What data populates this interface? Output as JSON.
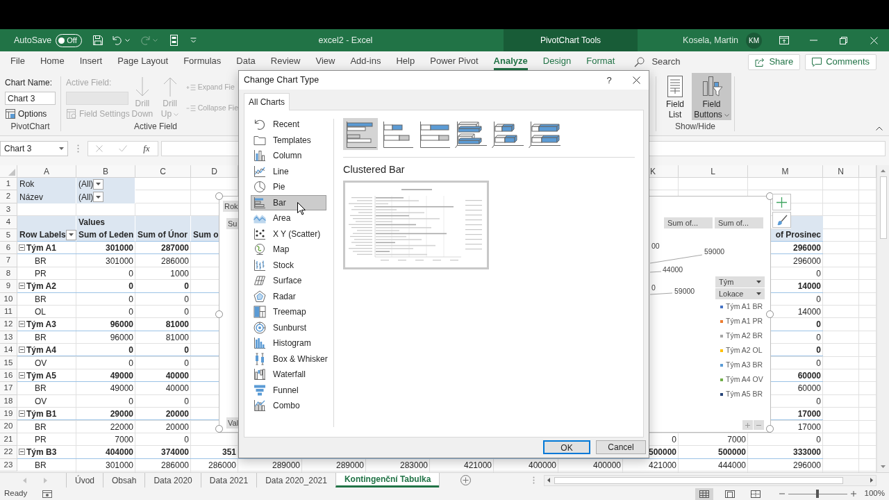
{
  "title_bar": {
    "autosave_label": "AutoSave",
    "autosave": {
      "on": false,
      "label": "Off"
    },
    "document_title": "excel2 - Excel",
    "context_label": "PivotChart Tools",
    "user_name": "Kosela, Martin",
    "user_initials": "KM"
  },
  "menu_tabs": [
    {
      "label": "File",
      "selected": false,
      "contextual": false
    },
    {
      "label": "Home",
      "selected": false,
      "contextual": false
    },
    {
      "label": "Insert",
      "selected": false,
      "contextual": false
    },
    {
      "label": "Page Layout",
      "selected": false,
      "contextual": false
    },
    {
      "label": "Formulas",
      "selected": false,
      "contextual": false
    },
    {
      "label": "Data",
      "selected": false,
      "contextual": false
    },
    {
      "label": "Review",
      "selected": false,
      "contextual": false
    },
    {
      "label": "View",
      "selected": false,
      "contextual": false
    },
    {
      "label": "Add-ins",
      "selected": false,
      "contextual": false
    },
    {
      "label": "Help",
      "selected": false,
      "contextual": false
    },
    {
      "label": "Power Pivot",
      "selected": false,
      "contextual": false
    },
    {
      "label": "Analyze",
      "selected": true,
      "contextual": true
    },
    {
      "label": "Design",
      "selected": false,
      "contextual": true
    },
    {
      "label": "Format",
      "selected": false,
      "contextual": true
    }
  ],
  "search": {
    "placeholder": "Search"
  },
  "share_button": "Share",
  "comments_button": "Comments",
  "ribbon": {
    "pivotchart": {
      "group_label": "PivotChart",
      "name_label": "Chart Name:",
      "name_value": "Chart 3",
      "options": "Options"
    },
    "active_field": {
      "group_label": "Active Field",
      "disabled": true,
      "field_label": "Active Field:",
      "field_settings": "Field Settings",
      "drill_down": "Drill Down",
      "drill_up": "Drill Up",
      "expand": "Expand Fie",
      "collapse": "Collapse Fie"
    },
    "show_hide": {
      "group_label": "Show/Hide",
      "buttons": [
        {
          "label": "Field List",
          "pressed": false
        },
        {
          "label": "Field Buttons",
          "pressed": true
        }
      ]
    }
  },
  "formula_bar": {
    "name_box": "Chart 3",
    "function_label": "fx"
  },
  "sheet": {
    "column_headers": {
      "col_a": "A",
      "col_b": "B",
      "col_c": "C",
      "col_d": "D",
      "col_k": "K",
      "col_l": "L",
      "col_m": "M",
      "col_n": "N"
    },
    "rows": [
      {
        "number": "1",
        "kind": "filter",
        "cells": {
          "col_a": "Rok",
          "col_b": "(All)"
        }
      },
      {
        "number": "2",
        "kind": "filter",
        "cells": {
          "col_a": "Název",
          "col_b": "(All)"
        }
      },
      {
        "number": "3",
        "kind": "blank"
      },
      {
        "number": "4",
        "kind": "values_header",
        "cells": {
          "col_b": "Values"
        }
      },
      {
        "number": "5",
        "kind": "column_labels",
        "cells": {
          "col_a": "Row Labels",
          "col_b": "Sum of Leden",
          "col_c": "Sum of Únor",
          "col_d": "Sum o",
          "col_m": "of Prosinec"
        }
      },
      {
        "number": "6",
        "kind": "group",
        "expanded": true,
        "cells": {
          "col_a": "Tým A1",
          "col_b": "301000",
          "col_c": "287000",
          "col_m": "296000"
        }
      },
      {
        "number": "7",
        "kind": "item",
        "cells": {
          "col_a": "BR",
          "col_b": "301000",
          "col_c": "286000",
          "col_m": "296000"
        }
      },
      {
        "number": "8",
        "kind": "item",
        "cells": {
          "col_a": "PR",
          "col_b": "0",
          "col_c": "1000",
          "col_m": "0"
        }
      },
      {
        "number": "9",
        "kind": "group",
        "expanded": true,
        "cells": {
          "col_a": "Tým A2",
          "col_b": "0",
          "col_c": "0",
          "col_m": "14000"
        }
      },
      {
        "number": "10",
        "kind": "item",
        "cells": {
          "col_a": "BR",
          "col_b": "0",
          "col_c": "0",
          "col_m": "0"
        }
      },
      {
        "number": "11",
        "kind": "item",
        "cells": {
          "col_a": "OL",
          "col_b": "0",
          "col_c": "0",
          "col_m": "14000"
        }
      },
      {
        "number": "12",
        "kind": "group",
        "expanded": true,
        "cells": {
          "col_a": "Tým A3",
          "col_b": "96000",
          "col_c": "81000",
          "col_m": "0"
        }
      },
      {
        "number": "13",
        "kind": "item",
        "cells": {
          "col_a": "BR",
          "col_b": "96000",
          "col_c": "81000",
          "col_m": "0"
        }
      },
      {
        "number": "14",
        "kind": "group",
        "expanded": true,
        "cells": {
          "col_a": "Tým A4",
          "col_b": "0",
          "col_c": "0",
          "col_m": "0"
        }
      },
      {
        "number": "15",
        "kind": "item",
        "cells": {
          "col_a": "OV",
          "col_b": "0",
          "col_c": "0",
          "col_m": "0"
        }
      },
      {
        "number": "16",
        "kind": "group",
        "expanded": true,
        "cells": {
          "col_a": "Tým A5",
          "col_b": "49000",
          "col_c": "40000",
          "col_m": "60000"
        }
      },
      {
        "number": "17",
        "kind": "item",
        "cells": {
          "col_a": "BR",
          "col_b": "49000",
          "col_c": "40000",
          "col_m": "60000"
        }
      },
      {
        "number": "18",
        "kind": "item",
        "cells": {
          "col_a": "OV",
          "col_b": "0",
          "col_c": "0",
          "col_m": "0"
        }
      },
      {
        "number": "19",
        "kind": "group",
        "expanded": true,
        "cells": {
          "col_a": "Tým B1",
          "col_b": "29000",
          "col_c": "20000",
          "col_m": "17000"
        }
      },
      {
        "number": "20",
        "kind": "item",
        "cells": {
          "col_a": "BR",
          "col_b": "22000",
          "col_c": "20000",
          "col_m": "17000"
        }
      },
      {
        "number": "21",
        "kind": "item",
        "cells": {
          "col_a": "PR",
          "col_b": "7000",
          "col_c": "0",
          "col_k": "0",
          "col_l": "7000",
          "col_m": "0"
        }
      },
      {
        "number": "22",
        "kind": "group",
        "expanded": true,
        "cells": {
          "col_a": "Tým B3",
          "col_b": "404000",
          "col_c": "374000",
          "col_d": "351",
          "col_k": "500000",
          "col_l": "500000",
          "col_m": "333000"
        }
      },
      {
        "number": "23",
        "kind": "item",
        "cells": {
          "col_a": "BR",
          "col_b": "301000",
          "col_c": "286000",
          "col_d": "286000",
          "col_e": "289000",
          "col_f": "289000",
          "col_g": "283000",
          "col_h": "421000",
          "col_i": "400000",
          "col_j": "400000",
          "col_k": "421000",
          "col_l": "444000",
          "col_m": "296000"
        }
      }
    ]
  },
  "pivot_chart": {
    "left_buttons": [
      "Rok",
      "Su",
      "Val"
    ],
    "value_buttons": [
      "Sum of...",
      "Sum of..."
    ],
    "data_labels": [
      "00",
      "59000",
      "44000",
      "0",
      "59000"
    ],
    "legend_fields": [
      "Tým",
      "Lokace"
    ],
    "legend": [
      {
        "label": "Tým A1 BR",
        "color": "#4472c4"
      },
      {
        "label": "Tým A1 PR",
        "color": "#ed7d31"
      },
      {
        "label": "Tým A2 BR",
        "color": "#a5a5a5"
      },
      {
        "label": "Tým A2 OL",
        "color": "#ffc000"
      },
      {
        "label": "Tým A3 BR",
        "color": "#5b9bd5"
      },
      {
        "label": "Tým A4 OV",
        "color": "#70ad47"
      },
      {
        "label": "Tým A5 BR",
        "color": "#264478"
      }
    ]
  },
  "dialog": {
    "title": "Change Chart Type",
    "help": "?",
    "tabs": [
      {
        "label": "All Charts",
        "selected": true
      }
    ],
    "chart_types": [
      {
        "label": "Recent",
        "selected": false
      },
      {
        "label": "Templates",
        "selected": false
      },
      {
        "label": "Column",
        "selected": false
      },
      {
        "label": "Line",
        "selected": false
      },
      {
        "label": "Pie",
        "selected": false
      },
      {
        "label": "Bar",
        "selected": true
      },
      {
        "label": "Area",
        "selected": false
      },
      {
        "label": "X Y (Scatter)",
        "selected": false
      },
      {
        "label": "Map",
        "selected": false
      },
      {
        "label": "Stock",
        "selected": false
      },
      {
        "label": "Surface",
        "selected": false
      },
      {
        "label": "Radar",
        "selected": false
      },
      {
        "label": "Treemap",
        "selected": false
      },
      {
        "label": "Sunburst",
        "selected": false
      },
      {
        "label": "Histogram",
        "selected": false
      },
      {
        "label": "Box & Whisker",
        "selected": false
      },
      {
        "label": "Waterfall",
        "selected": false
      },
      {
        "label": "Funnel",
        "selected": false
      },
      {
        "label": "Combo",
        "selected": false
      }
    ],
    "subtypes": [
      {
        "kind": "clustered",
        "selected": true
      },
      {
        "kind": "stacked",
        "selected": false
      },
      {
        "kind": "stacked_100",
        "selected": false
      },
      {
        "kind": "clustered_3d",
        "selected": false
      },
      {
        "kind": "stacked_3d",
        "selected": false
      },
      {
        "kind": "stacked_100_3d",
        "selected": false
      }
    ],
    "subtype_name": "Clustered Bar",
    "buttons": [
      {
        "label": "OK",
        "default": true
      },
      {
        "label": "Cancel",
        "default": false
      }
    ]
  },
  "sheet_tabs": [
    {
      "label": "Úvod",
      "selected": false
    },
    {
      "label": "Obsah",
      "selected": false
    },
    {
      "label": "Data 2020",
      "selected": false
    },
    {
      "label": "Data 2021",
      "selected": false
    },
    {
      "label": "Data 2020_2021",
      "selected": false
    },
    {
      "label": "Kontingenční Tabulka",
      "selected": true
    }
  ],
  "status_bar": {
    "text": "Ready",
    "views": [
      {
        "selected": true
      },
      {
        "selected": false
      },
      {
        "selected": false
      }
    ],
    "zoom": {
      "level": 0.5,
      "label": "100%"
    }
  }
}
